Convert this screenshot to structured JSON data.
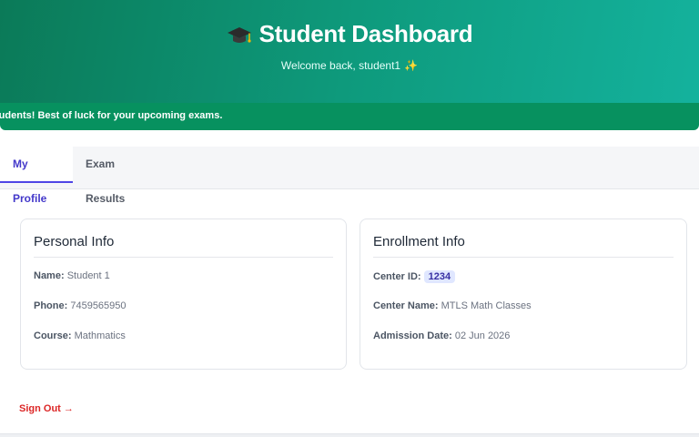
{
  "header": {
    "title": "Student Dashboard",
    "welcome": "Welcome back, student1",
    "welcome_emoji": "✨",
    "icon": "graduation-cap-icon"
  },
  "ticker": {
    "text": "ome Students! Best of luck for your upcoming exams."
  },
  "tabs": [
    {
      "label": "My Profile",
      "active": true
    },
    {
      "label": "Exam Results",
      "active": false
    }
  ],
  "personal_info": {
    "title": "Personal Info",
    "fields": [
      {
        "label": "Name:",
        "value": "Student 1"
      },
      {
        "label": "Phone:",
        "value": "7459565950"
      },
      {
        "label": "Course:",
        "value": "Mathmatics"
      }
    ]
  },
  "enrollment_info": {
    "title": "Enrollment Info",
    "fields": [
      {
        "label": "Center ID:",
        "value": "1234"
      },
      {
        "label": "Center Name:",
        "value": "MTLS Math Classes"
      },
      {
        "label": "Admission Date:",
        "value": "02 Jun 2026"
      }
    ]
  },
  "actions": {
    "sign_out": "Sign Out →"
  },
  "colors": {
    "header_start": "#0b7a58",
    "header_end": "#14b29d",
    "ticker_bg": "#07915f",
    "active_tab": "#4f46e5",
    "sign_out": "#dc2626",
    "badge_bg": "#e0e7ff"
  }
}
